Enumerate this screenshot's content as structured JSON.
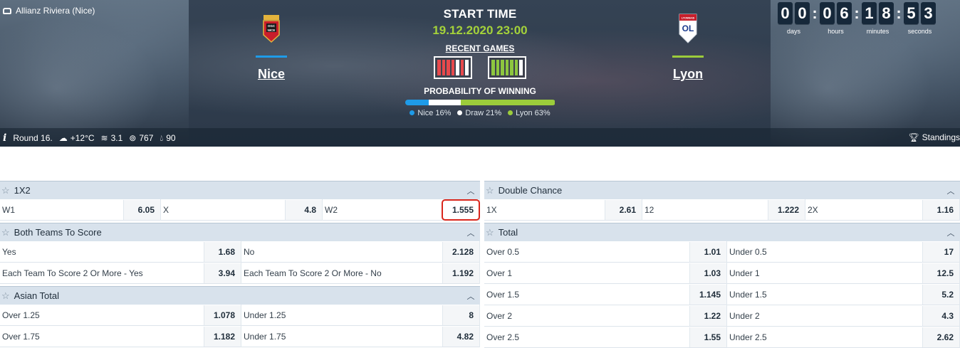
{
  "header": {
    "venue": "Allianz Riviera (Nice)",
    "start_label": "START TIME",
    "start_time": "19.12.2020 23:00",
    "recent_label": "RECENT GAMES",
    "prob_label": "PROBABILITY OF WINNING",
    "home": {
      "name": "Nice",
      "crest_text": "OGC NICE",
      "color": "#1e9be8",
      "recent": [
        "#e8494c",
        "#e8494c",
        "#e8494c",
        "#e8494c",
        "#ffffff",
        "#e8494c",
        "#ffffff"
      ]
    },
    "away": {
      "name": "Lyon",
      "crest_text": "OL",
      "color": "#9ccc3b",
      "recent": [
        "#8dc63f",
        "#8dc63f",
        "#8dc63f",
        "#8dc63f",
        "#8dc63f",
        "#8dc63f",
        "#ffffff"
      ]
    },
    "probability": [
      {
        "label": "Nice 16%",
        "value": 0.16,
        "color": "#1e9be8"
      },
      {
        "label": "Draw 21%",
        "value": 0.21,
        "color": "#ffffff"
      },
      {
        "label": "Lyon 63%",
        "value": 0.63,
        "color": "#9ccc3b"
      }
    ],
    "countdown": {
      "days": [
        "0",
        "0"
      ],
      "hours": [
        "0",
        "6"
      ],
      "minutes": [
        "1",
        "8"
      ],
      "seconds": [
        "5",
        "3"
      ],
      "units": {
        "days": "days",
        "hours": "hours",
        "minutes": "minutes",
        "seconds": "seconds"
      }
    },
    "info": {
      "round": "Round 16.",
      "temperature": "+12°C",
      "wind": "3.1",
      "pressure": "767",
      "humidity": "90"
    },
    "standings": "Standings"
  },
  "markets": {
    "x12": {
      "title": "1X2",
      "rows": [
        [
          {
            "label": "W1",
            "odd": "6.05"
          },
          {
            "label": "X",
            "odd": "4.8"
          },
          {
            "label": "W2",
            "odd": "1.555"
          }
        ]
      ]
    },
    "double_chance": {
      "title": "Double Chance",
      "rows": [
        [
          {
            "label": "1X",
            "odd": "2.61"
          },
          {
            "label": "12",
            "odd": "1.222"
          },
          {
            "label": "2X",
            "odd": "1.16"
          }
        ]
      ]
    },
    "btts": {
      "title": "Both Teams To Score",
      "rows": [
        [
          {
            "label": "Yes",
            "odd": "1.68"
          },
          {
            "label": "No",
            "odd": "2.128"
          }
        ],
        [
          {
            "label": "Each Team To Score 2 Or More - Yes",
            "odd": "3.94"
          },
          {
            "label": "Each Team To Score 2 Or More - No",
            "odd": "1.192"
          }
        ]
      ]
    },
    "asian_total": {
      "title": "Asian Total",
      "rows": [
        [
          {
            "label": "Over 1.25",
            "odd": "1.078"
          },
          {
            "label": "Under 1.25",
            "odd": "8"
          }
        ],
        [
          {
            "label": "Over 1.75",
            "odd": "1.182"
          },
          {
            "label": "Under 1.75",
            "odd": "4.82"
          }
        ]
      ]
    },
    "total": {
      "title": "Total",
      "rows": [
        [
          {
            "label": "Over 0.5",
            "odd": "1.01"
          },
          {
            "label": "Under 0.5",
            "odd": "17"
          }
        ],
        [
          {
            "label": "Over 1",
            "odd": "1.03"
          },
          {
            "label": "Under 1",
            "odd": "12.5"
          }
        ],
        [
          {
            "label": "Over 1.5",
            "odd": "1.145"
          },
          {
            "label": "Under 1.5",
            "odd": "5.2"
          }
        ],
        [
          {
            "label": "Over 2",
            "odd": "1.22"
          },
          {
            "label": "Under 2",
            "odd": "4.3"
          }
        ],
        [
          {
            "label": "Over 2.5",
            "odd": "1.55"
          },
          {
            "label": "Under 2.5",
            "odd": "2.62"
          }
        ]
      ]
    }
  }
}
